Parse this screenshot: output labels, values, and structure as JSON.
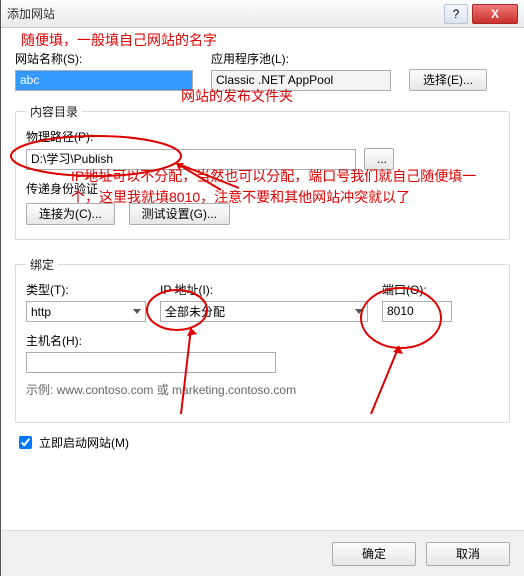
{
  "titlebar": {
    "title": "添加网站",
    "help": "?",
    "close": "X"
  },
  "siteName": {
    "label": "网站名称(S):",
    "value": "abc"
  },
  "appPool": {
    "label": "应用程序池(L):",
    "value": "Classic .NET AppPool",
    "selectBtn": "选择(E)..."
  },
  "content": {
    "legend": "内容目录",
    "pathLabel": "物理路径(P):",
    "pathValue": "D:\\学习\\Publish",
    "browseBtn": "...",
    "authLabel": "传递身份验证",
    "connectBtn": "连接为(C)...",
    "testBtn": "测试设置(G)..."
  },
  "binding": {
    "legend": "绑定",
    "typeLabel": "类型(T):",
    "typeValue": "http",
    "ipLabel": "IP 地址(I):",
    "ipValue": "全部未分配",
    "portLabel": "端口(O):",
    "portValue": "8010",
    "hostLabel": "主机名(H):",
    "hostValue": "",
    "example": "示例: www.contoso.com 或 marketing.contoso.com"
  },
  "startSite": {
    "label": "立即启动网站(M)",
    "checked": true
  },
  "buttons": {
    "ok": "确定",
    "cancel": "取消"
  },
  "annotations": {
    "a1": "随便填，一般填自己网站的名字",
    "a2": "网站的发布文件夹",
    "a3": "IP地址可以不分配，当然也可以分配，端口号我们就自己随便填一个，这里我就填8010，注意不要和其他网站冲突就以了"
  }
}
